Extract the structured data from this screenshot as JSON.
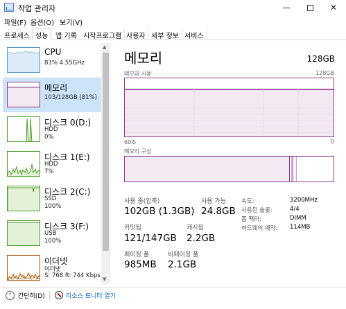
{
  "window": {
    "title": "작업 관리자",
    "controls": {
      "minimize": "minimize",
      "maximize": "maximize",
      "close": "✕"
    }
  },
  "menu": {
    "items": [
      "파일(F)",
      "옵션(O)",
      "보기(V)"
    ]
  },
  "tabs": [
    {
      "label": "프로세스",
      "active": false
    },
    {
      "label": "성능",
      "active": true
    },
    {
      "label": "앱 기록",
      "active": false
    },
    {
      "label": "시작프로그램",
      "active": false
    },
    {
      "label": "사용자",
      "active": false
    },
    {
      "label": "세부 정보",
      "active": false
    },
    {
      "label": "서비스",
      "active": false
    }
  ],
  "sidebar": {
    "items": [
      {
        "name": "CPU",
        "sub1": "83% 4.55GHz",
        "sub2": "",
        "sub3": "",
        "icon": "cpu-graph",
        "color": "#4594c9"
      },
      {
        "name": "메모리",
        "sub1": "103/128GB (81%)",
        "sub2": "",
        "sub3": "",
        "icon": "memory-graph",
        "color": "#8b3a8b",
        "selected": true
      },
      {
        "name": "디스크 0(D:)",
        "sub1": "HDD",
        "sub2": "0%",
        "sub3": "",
        "icon": "disk-graph",
        "color": "#4d9a28"
      },
      {
        "name": "디스크 1(E:)",
        "sub1": "HDD",
        "sub2": "7%",
        "sub3": "",
        "icon": "disk-graph",
        "color": "#4d9a28"
      },
      {
        "name": "디스크 2(C:)",
        "sub1": "SSD",
        "sub2": "100%",
        "sub3": "",
        "icon": "disk-graph",
        "color": "#4d9a28"
      },
      {
        "name": "디스크 3(F:)",
        "sub1": "USB",
        "sub2": "100%",
        "sub3": "",
        "icon": "disk-graph",
        "color": "#4d9a28"
      },
      {
        "name": "이더넷",
        "sub1": "이더넷",
        "sub2": "S: 768 R: 744 Kbps",
        "sub3": "",
        "icon": "network-graph",
        "color": "#a74f00"
      }
    ]
  },
  "main": {
    "title": "메모리",
    "capacity": "128GB",
    "usage_label": "메모리 사용",
    "usage_max": "128GB",
    "axis_left": "60초",
    "axis_right": "0",
    "composition_label": "메모리 구성",
    "stats": {
      "in_use_label": "사용 중(압축)",
      "in_use_value": "102GB (1.3GB)",
      "available_label": "사용 가능",
      "available_value": "24.8GB",
      "committed_label": "커밋됨",
      "committed_value": "121/147GB",
      "cached_label": "캐시됨",
      "cached_value": "2.2GB",
      "paged_label": "페이징 풀",
      "paged_value": "985MB",
      "nonpaged_label": "비페이징 풀",
      "nonpaged_value": "2.1GB"
    },
    "details": {
      "speed_label": "속도:",
      "speed_value": "3200MHz",
      "slots_label": "사용된 슬롯:",
      "slots_value": "4/4",
      "form_label": "폼 팩터:",
      "form_value": "DIMM",
      "reserved_label": "하드웨어 예약:",
      "reserved_value": "114MB"
    }
  },
  "footer": {
    "fewer_details": "간단히(D)",
    "resource_monitor": "리소스 모니터 열기"
  },
  "colors": {
    "memory": "#8b3a8b",
    "cpu": "#4594c9",
    "disk": "#4d9a28",
    "network": "#a74f00",
    "selection": "#cce4f7"
  }
}
